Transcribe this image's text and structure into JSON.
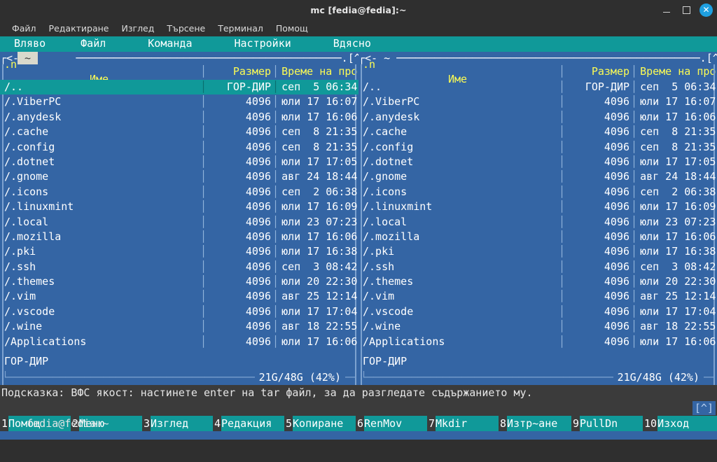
{
  "window": {
    "title": "mc [fedia@fedia]:~",
    "controls": {
      "minimize": "minimize",
      "maximize": "maximize",
      "close": "✕"
    }
  },
  "gtk_menu": {
    "items": [
      "Файл",
      "Редактиране",
      "Изглед",
      "Търсене",
      "Терминал",
      "Помощ"
    ]
  },
  "mc_menu": {
    "items": [
      "Вляво",
      "Файл",
      "Команда",
      "Настройки",
      "Вдясно"
    ]
  },
  "colors": {
    "panel_bg": "#3465a4",
    "selection_bg": "#109999",
    "menubar_bg": "#109999",
    "header_text": "#fcfc54",
    "frame": "#7da2d0",
    "terminal_dark": "#3b3b3b",
    "titlebar_bg": "#2f2f2f",
    "close_button": "#1e9fe0"
  },
  "columns": {
    "sort_indicator": ".n",
    "name": "Име",
    "size": "Размер",
    "time": "Време на про"
  },
  "panels": {
    "left": {
      "active": true,
      "path_prefix": "<-",
      "path": "~",
      "path_suffix": ".[^]>",
      "mini_status": "ГОР-ДИР",
      "free_space": "21G/48G (42%)",
      "selected_index": 0
    },
    "right": {
      "active": false,
      "path_prefix": "<-",
      "path": "~",
      "path_suffix": ".[^]>",
      "mini_status": "ГОР-ДИР",
      "free_space": "21G/48G (42%)",
      "selected_index": -1
    }
  },
  "files": [
    {
      "name": "/..",
      "size": "ГОР-ДИР",
      "time": "сеп  5 06:34"
    },
    {
      "name": "/.ViberPC",
      "size": "4096",
      "time": "юли 17 16:07"
    },
    {
      "name": "/.anydesk",
      "size": "4096",
      "time": "юли 17 16:06"
    },
    {
      "name": "/.cache",
      "size": "4096",
      "time": "сеп  8 21:35"
    },
    {
      "name": "/.config",
      "size": "4096",
      "time": "сеп  8 21:35"
    },
    {
      "name": "/.dotnet",
      "size": "4096",
      "time": "юли 17 17:05"
    },
    {
      "name": "/.gnome",
      "size": "4096",
      "time": "авг 24 18:44"
    },
    {
      "name": "/.icons",
      "size": "4096",
      "time": "сеп  2 06:38"
    },
    {
      "name": "/.linuxmint",
      "size": "4096",
      "time": "юли 17 16:09"
    },
    {
      "name": "/.local",
      "size": "4096",
      "time": "юли 23 07:23"
    },
    {
      "name": "/.mozilla",
      "size": "4096",
      "time": "юли 17 16:06"
    },
    {
      "name": "/.pki",
      "size": "4096",
      "time": "юли 17 16:38"
    },
    {
      "name": "/.ssh",
      "size": "4096",
      "time": "сеп  3 08:42"
    },
    {
      "name": "/.themes",
      "size": "4096",
      "time": "юли 20 22:30"
    },
    {
      "name": "/.vim",
      "size": "4096",
      "time": "авг 25 12:14"
    },
    {
      "name": "/.vscode",
      "size": "4096",
      "time": "юли 17 17:04"
    },
    {
      "name": "/.wine",
      "size": "4096",
      "time": "авг 18 22:55"
    },
    {
      "name": "/Applications",
      "size": "4096",
      "time": "юли 17 16:06"
    }
  ],
  "hint": {
    "text": "Подсказка: ВФС якост: настинете enter на tar файл, за да разгледате съдържанието му."
  },
  "shell": {
    "prompt": "fedia@fedia:~",
    "command": "",
    "scroll_indicator": "[^]"
  },
  "function_keys": [
    {
      "num": "1",
      "label": "Помощ"
    },
    {
      "num": "2",
      "label": "Меню"
    },
    {
      "num": "3",
      "label": "Изглед"
    },
    {
      "num": "4",
      "label": "Редакция"
    },
    {
      "num": "5",
      "label": "Копиране"
    },
    {
      "num": "6",
      "label": "RenMov"
    },
    {
      "num": "7",
      "label": "Mkdir"
    },
    {
      "num": "8",
      "label": "Изтр~ане"
    },
    {
      "num": "9",
      "label": "PullDn"
    },
    {
      "num": "10",
      "label": "Изход"
    }
  ]
}
